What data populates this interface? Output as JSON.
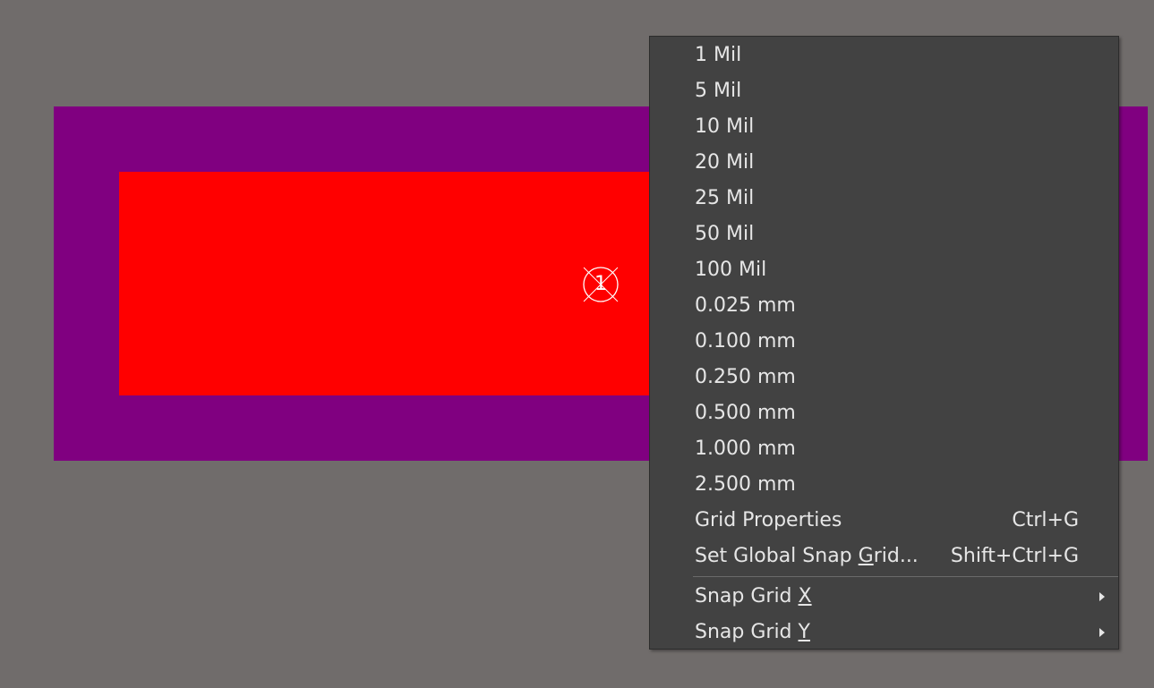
{
  "canvas": {
    "background": "#706c6b",
    "pad_outer_color": "#800080",
    "pad_inner_color": "#ff0000",
    "pad_number": "1"
  },
  "menu": {
    "grid_items": [
      {
        "label": "1 Mil"
      },
      {
        "label": "5 Mil"
      },
      {
        "label": "10 Mil"
      },
      {
        "label": "20 Mil"
      },
      {
        "label": "25 Mil"
      },
      {
        "label": "50 Mil"
      },
      {
        "label": "100 Mil"
      },
      {
        "label": "0.025 mm"
      },
      {
        "label": "0.100 mm"
      },
      {
        "label": "0.250 mm"
      },
      {
        "label": "0.500 mm"
      },
      {
        "label": "1.000 mm"
      },
      {
        "label": "2.500 mm"
      }
    ],
    "grid_properties": {
      "label": "Grid Properties",
      "shortcut": "Ctrl+G"
    },
    "set_global_snap_grid": {
      "label_pre": "Set Global Snap ",
      "label_accel": "G",
      "label_post": "rid...",
      "shortcut": "Shift+Ctrl+G"
    },
    "snap_grid_x": {
      "label_pre": "Snap Grid ",
      "label_accel": "X"
    },
    "snap_grid_y": {
      "label_pre": "Snap Grid ",
      "label_accel": "Y"
    }
  }
}
